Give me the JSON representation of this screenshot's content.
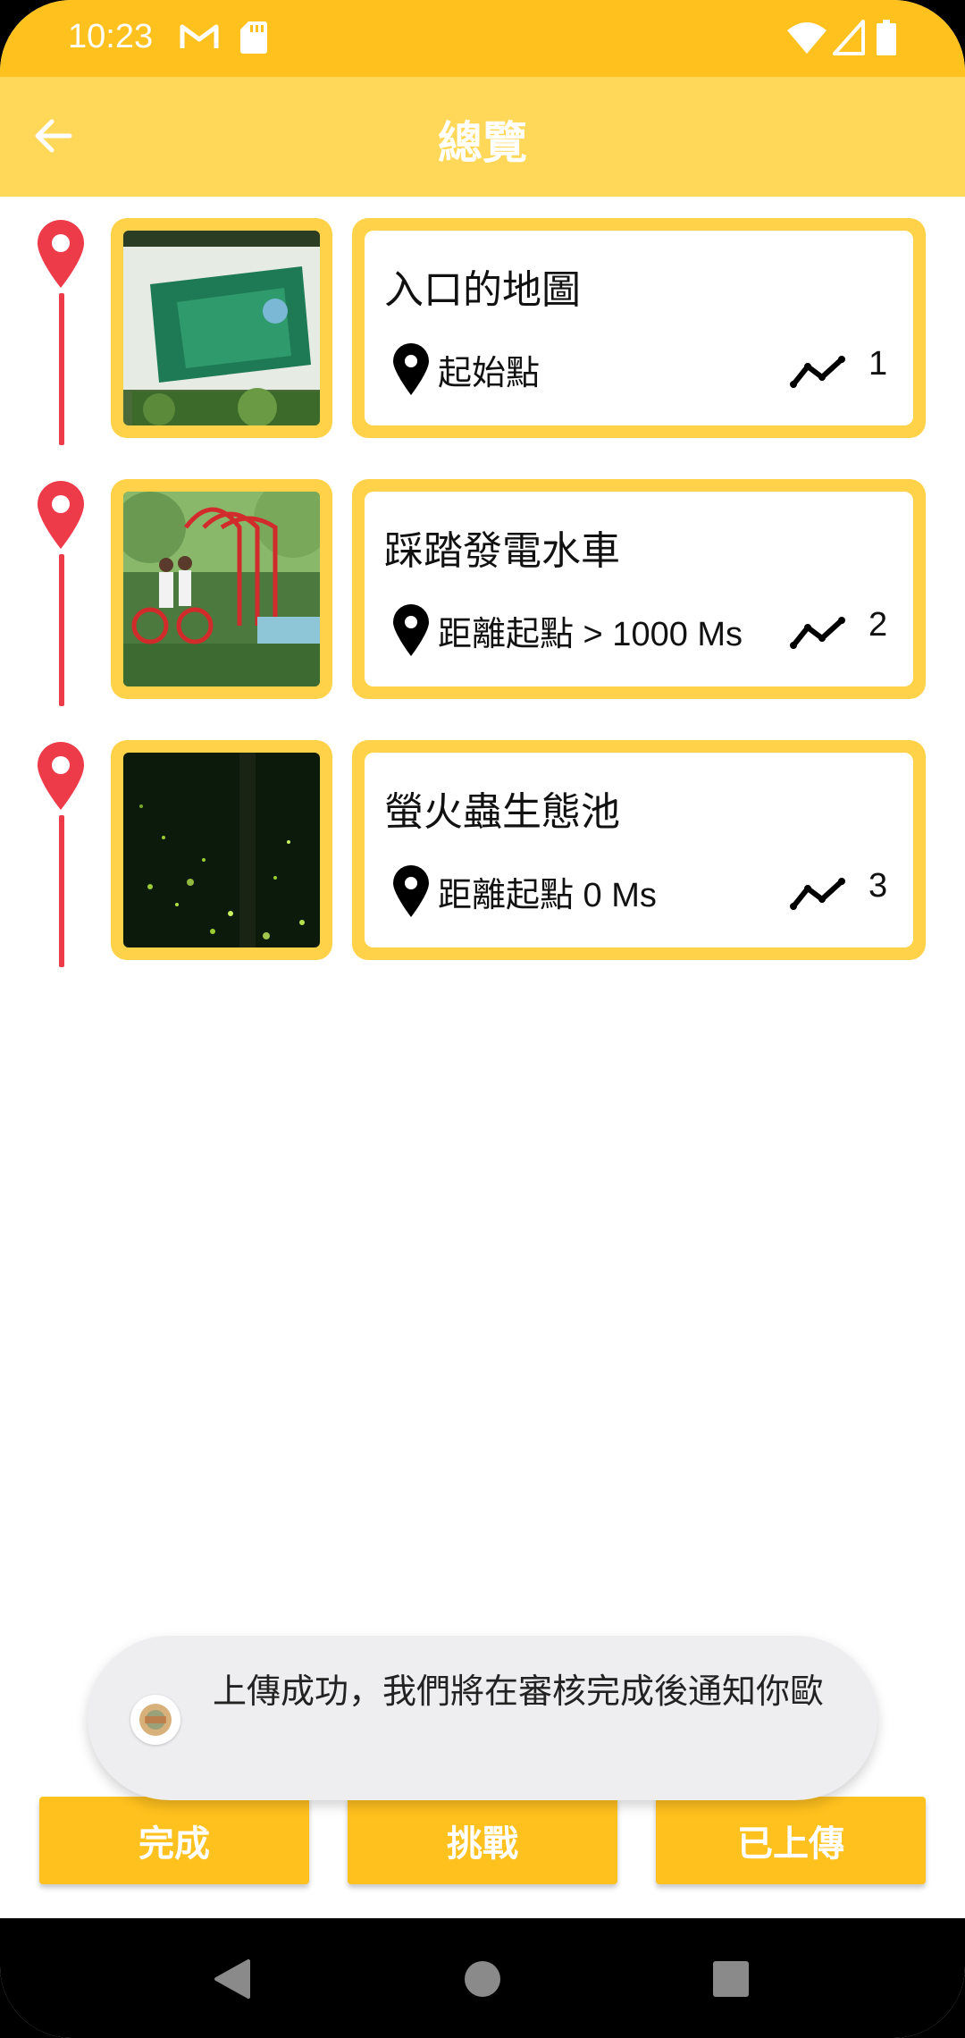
{
  "status_bar": {
    "time": "10:23",
    "icons": [
      "gmail-icon",
      "sd-card-icon",
      "wifi-icon",
      "cellular-icon",
      "battery-icon"
    ],
    "background_color": "#FFC11E"
  },
  "app_bar": {
    "title": "總覽",
    "back_icon": "arrow-left-icon",
    "background_color": "#FFD85A"
  },
  "timeline": {
    "marker_color": "#EE3B4A",
    "card_border_color": "#FFD24A",
    "items": [
      {
        "title": "入口的地圖",
        "distance": "起始點",
        "order": "1",
        "image": "park-map-photo"
      },
      {
        "title": "踩踏發電水車",
        "distance": "距離起點 > 1000 Ms",
        "order": "2",
        "image": "pedal-bicycle-photo"
      },
      {
        "title": "螢火蟲生態池",
        "distance": "距離起點 0 Ms",
        "order": "3",
        "image": "firefly-night-photo"
      }
    ]
  },
  "toast": {
    "message": "上傳成功，我們將在審核完成後通知你歐",
    "avatar_icon": "app-avatar-icon"
  },
  "bottom_buttons": {
    "complete": "完成",
    "challenge": "挑戰",
    "uploaded": "已上傳",
    "color": "#FFC11E"
  },
  "nav_bar": {
    "icons": [
      "back-triangle-icon",
      "home-circle-icon",
      "recents-square-icon"
    ]
  }
}
